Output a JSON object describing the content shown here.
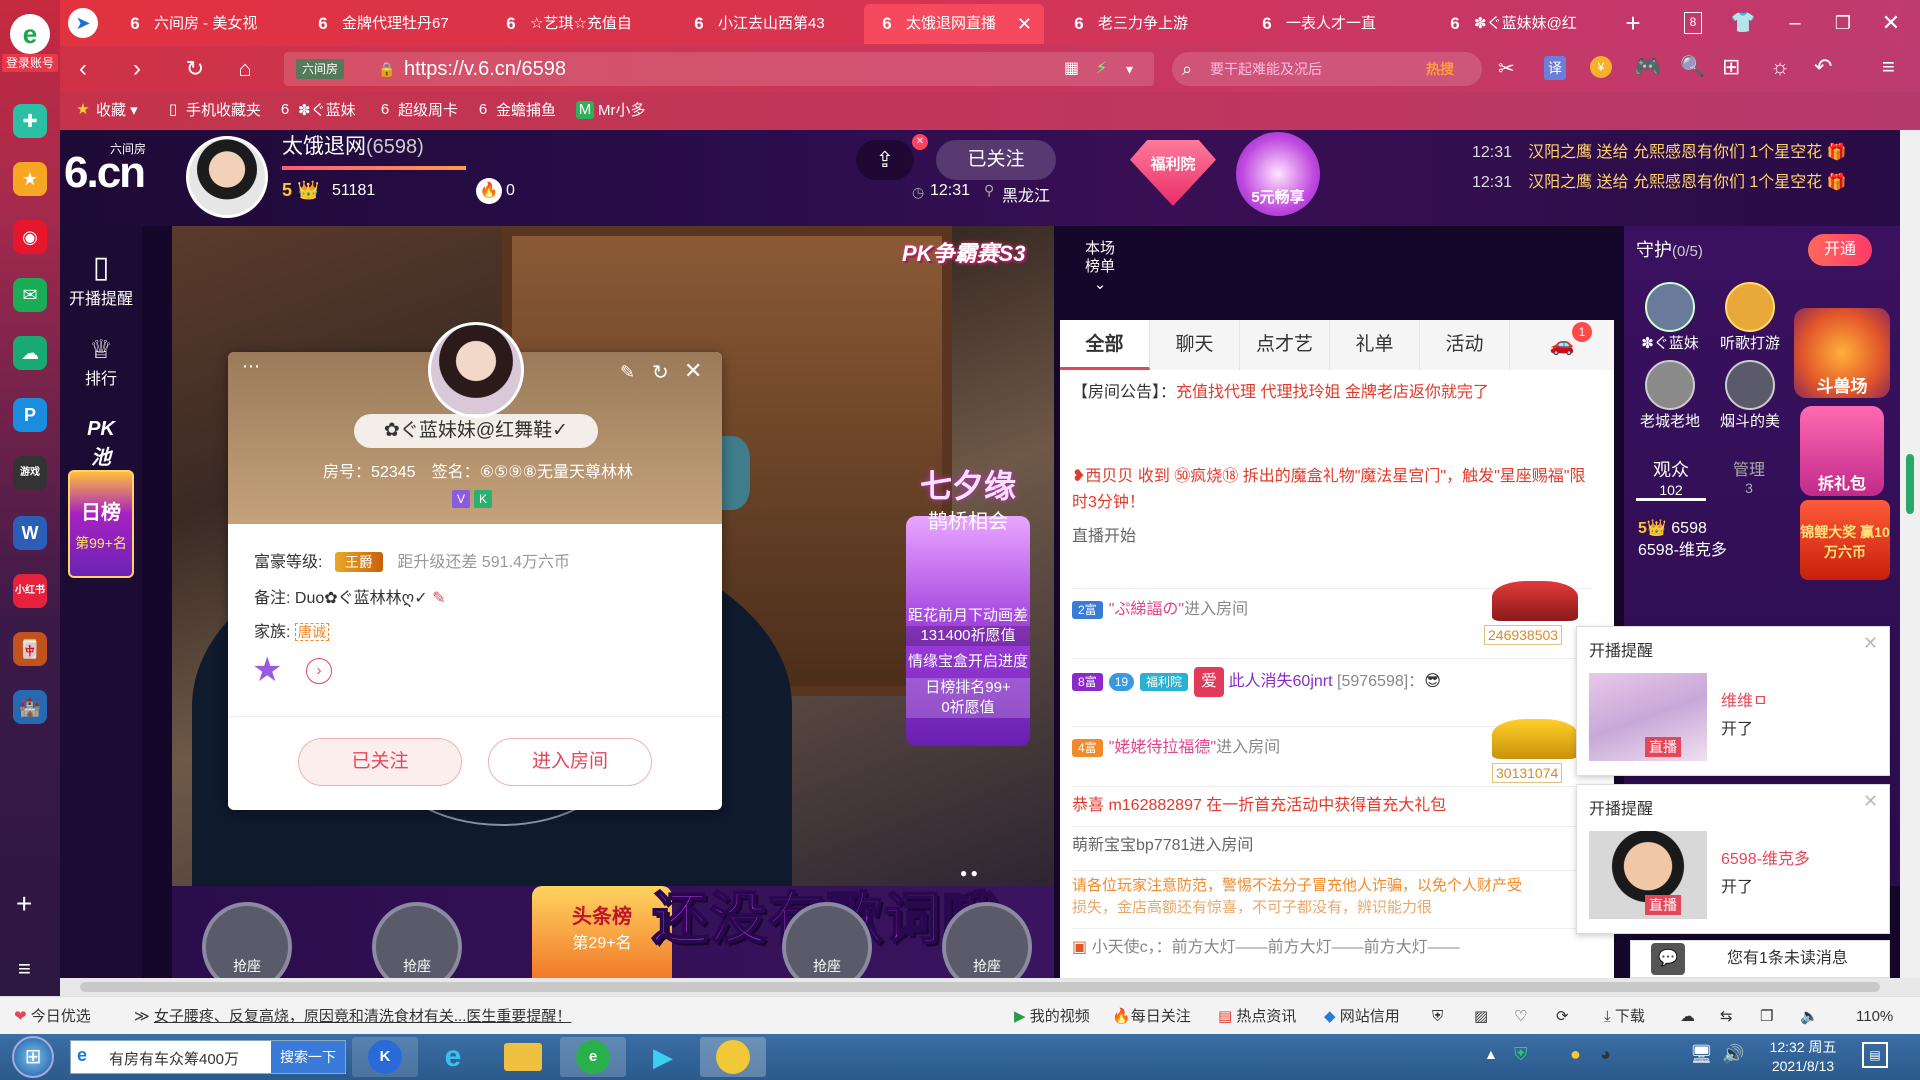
{
  "browser": {
    "login_label": "登录账号",
    "tabs": [
      {
        "label": "六间房 - 美女视",
        "icon": "6"
      },
      {
        "label": "金牌代理牡丹67",
        "icon": "6"
      },
      {
        "label": "☆艺琪☆充值自",
        "icon": "6"
      },
      {
        "label": "小江去山西第43",
        "icon": "6"
      },
      {
        "label": "太饿退网直播",
        "icon": "6",
        "active": true
      },
      {
        "label": "老三力争上游",
        "icon": "6"
      },
      {
        "label": "一表人才一直",
        "icon": "6"
      },
      {
        "label": "✽ぐ蓝妹妹@红",
        "icon": "6"
      }
    ],
    "tab_count": "8",
    "url": "https://v.6.cn/6598",
    "url_site_label": "六间房",
    "search_placeholder": "要干起难能及况后",
    "search_hot": "热搜",
    "bookmarks": [
      "收藏",
      "手机收藏夹",
      "✽ぐ蓝妹",
      "超级周卡",
      "金蟾捕鱼",
      "Mr小多"
    ]
  },
  "site": {
    "logo_text": "6.cn",
    "logo_sub": "六间房",
    "nav": [
      {
        "label": "开播提醒",
        "icon": "phone-icon"
      },
      {
        "label": "排行",
        "icon": "crown-icon"
      },
      {
        "label": "PK池",
        "icon": "pk-icon"
      }
    ],
    "daily_rank": {
      "title": "日榜",
      "rank": "第99+名"
    }
  },
  "streamer": {
    "name": "太饿退网",
    "room_id": "(6598)",
    "level": "5",
    "coins": "51181",
    "fire": "0",
    "time": "12:31",
    "location": "黑龙江",
    "follow_label": "已关注"
  },
  "header_right": {
    "welfare": "福利院",
    "five_yuan": "5元畅享",
    "feed": [
      {
        "time": "12:31",
        "text": "汉阳之鹰 送给 允熙感恩有你们 1个星空花"
      },
      {
        "time": "12:31",
        "text": "汉阳之鹰 送给 允熙感恩有你们 1个星空花"
      }
    ]
  },
  "video": {
    "pk_badge": "PK争霸赛S3",
    "qixi_title": "七夕缘",
    "qixi_sub": "鹊桥相会",
    "qixi_line1": "距花前月下动画差",
    "qixi_line2": "131400祈愿值",
    "qixi_line3": "情缘宝盒开启进度",
    "qixi_line4": "日榜排名99+",
    "qixi_line5": "0祈愿值",
    "lyrics": "还没有歌词哦",
    "seat_label": "抢座",
    "toutiao": "头条榜",
    "toutiao_rank": "第29+名"
  },
  "user_popup": {
    "name": "✿ぐ蓝妹妹@红舞鞋✓",
    "room_label": "房号：52345",
    "sign_label": "签名：⑥⑤⑨⑧无量天尊林林",
    "badges": [
      "V",
      "K"
    ],
    "wealth_label": "富豪等级:",
    "wealth_badge": "王爵",
    "wealth_upgrade": "距升级还差 591.4万六币",
    "note_label": "备注:",
    "note_value": "Duo✿ぐ蓝林林ღ✓",
    "family_label": "家族:",
    "family_value": "唐诚",
    "follow_btn": "已关注",
    "enter_btn": "进入房间"
  },
  "rank_board": {
    "label": "本场榜单"
  },
  "chat": {
    "tabs": [
      "全部",
      "聊天",
      "点才艺",
      "礼单",
      "活动"
    ],
    "car_count": "1",
    "notice_label": "【房间公告】：",
    "notice_text": "充值找代理 代理找玲姐 金牌老店返你就完了",
    "magic_text": "❥西贝贝 收到 ㊿疯烧⑱ 拆出的魔盒礼物\"魔法星宫门\"，触发\"星座赐福\"限时3分钟！",
    "live_start": "直播开始",
    "entries": [
      {
        "rich": "2富",
        "name": "\"ぷ綈諨の\"",
        "action": "进入房间",
        "car_id": "246938503"
      },
      {
        "rich": "8富",
        "name": "此人消失60jnrt",
        "uid": "[5976598]：",
        "tag1": "19",
        "tag2": "福利院"
      },
      {
        "rich": "4富",
        "name": "\"姥姥待拉福德\"",
        "action": "进入房间",
        "car_id": "30131074"
      }
    ],
    "congrats": "恭喜 m162882897 在一折首充活动中获得首充大礼包",
    "enter_msg": "萌新宝宝bp7781进入房间",
    "warning": "请各位玩家注意防范，警惕不法分子冒充他人诈骗，以免个人财产受",
    "warning2": "损失，金店高额还有惊喜，不可子都没有，辨识能力很",
    "input_hint": "小天使c，：前方大灯——前方大灯——前方大灯——"
  },
  "guard": {
    "title": "守护",
    "count": "(0/5)",
    "open_label": "开通",
    "members": [
      "✽ぐ蓝妹",
      "听歌打游",
      "老城老地",
      "烟斗的美"
    ],
    "arena": "斗兽场",
    "gift_box": "拆礼包",
    "audience_label": "观众",
    "audience_count": "102",
    "manage_label": "管理",
    "manage_count": "3",
    "koi": "锦鲤大奖 赢10万六币",
    "viewer_level": "5",
    "viewer_id": "6598",
    "viewer_name": "6598-维克多"
  },
  "notifications": [
    {
      "title": "开播提醒",
      "name": "维维ㅁ",
      "status": "开了",
      "live": "直播"
    },
    {
      "title": "开播提醒",
      "name": "6598-维克多",
      "status": "开了",
      "live": "直播"
    }
  ],
  "unread": "您有1条未读消息",
  "statusbar": {
    "today": "今日优选",
    "news": "女子腰疼、反复高烧，原因竟和清洗食材有关...医生重要提醒！",
    "items": [
      "我的视频",
      "每日关注",
      "热点资讯",
      "网站信用",
      "下载"
    ],
    "zoom": "110%"
  },
  "taskbar": {
    "search_text": "有房有车众筹400万",
    "search_btn": "搜索一下",
    "time": "12:32 周五",
    "date": "2021/8/13"
  },
  "colors": {
    "accent": "#e5475a",
    "tabbar": "#d8344f",
    "page_bg": "#14072a"
  }
}
